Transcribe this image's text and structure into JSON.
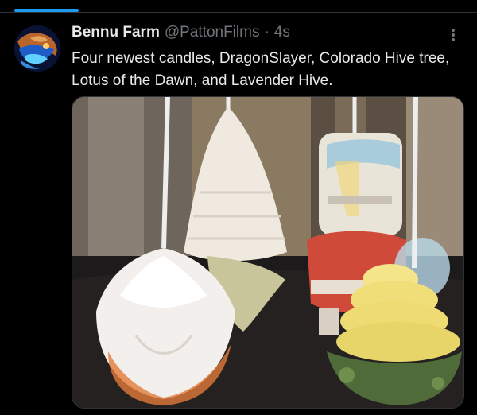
{
  "tweet": {
    "display_name": "Bennu Farm",
    "handle": "@PattonFilms",
    "separator": "·",
    "time": "4s",
    "text": "Four newest candles, DragonSlayer, Colorado Hive tree, Lotus of the Dawn, and Lavender Hive."
  },
  "icons": {
    "more": "more-vertical-icon",
    "avatar": "avatar-image"
  },
  "colors": {
    "accent": "#1d9bf0",
    "background": "#000000",
    "text_primary": "#e7e9ea",
    "text_secondary": "#71767b"
  }
}
